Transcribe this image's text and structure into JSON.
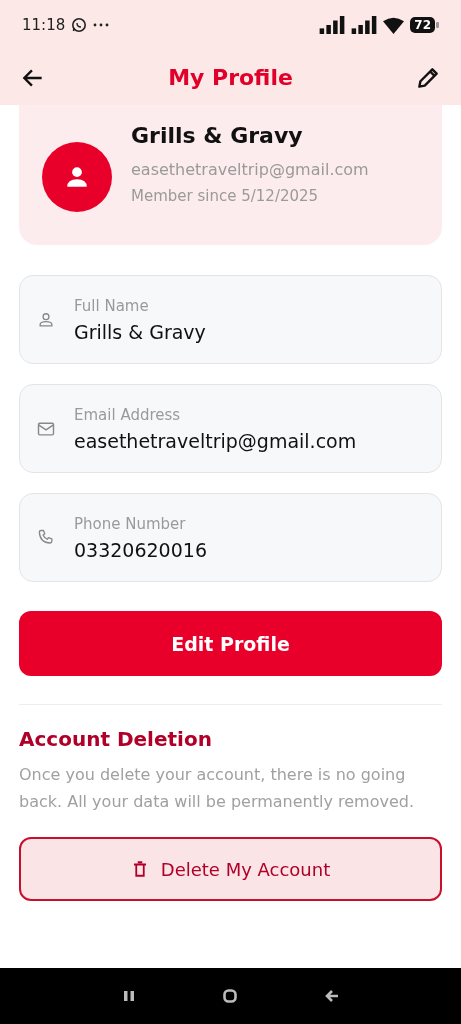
{
  "status_bar": {
    "time": "11:18",
    "battery": "72"
  },
  "app_bar": {
    "title": "My Profile"
  },
  "profile": {
    "name": "Grills & Gravy",
    "email": "easethetraveltrip@gmail.com",
    "member_since": "Member since 5/12/2025"
  },
  "fields": [
    {
      "kind": "person",
      "label": "Full Name",
      "value": "Grills & Gravy"
    },
    {
      "kind": "mail",
      "label": "Email Address",
      "value": "easethetraveltrip@gmail.com"
    },
    {
      "kind": "phone",
      "label": "Phone Number",
      "value": "03320620016"
    }
  ],
  "edit_button": "Edit Profile",
  "account_deletion": {
    "heading": "Account Deletion",
    "text": "Once you delete your account, there is no going back. All your data will be permanently removed.",
    "button": "Delete My Account"
  }
}
